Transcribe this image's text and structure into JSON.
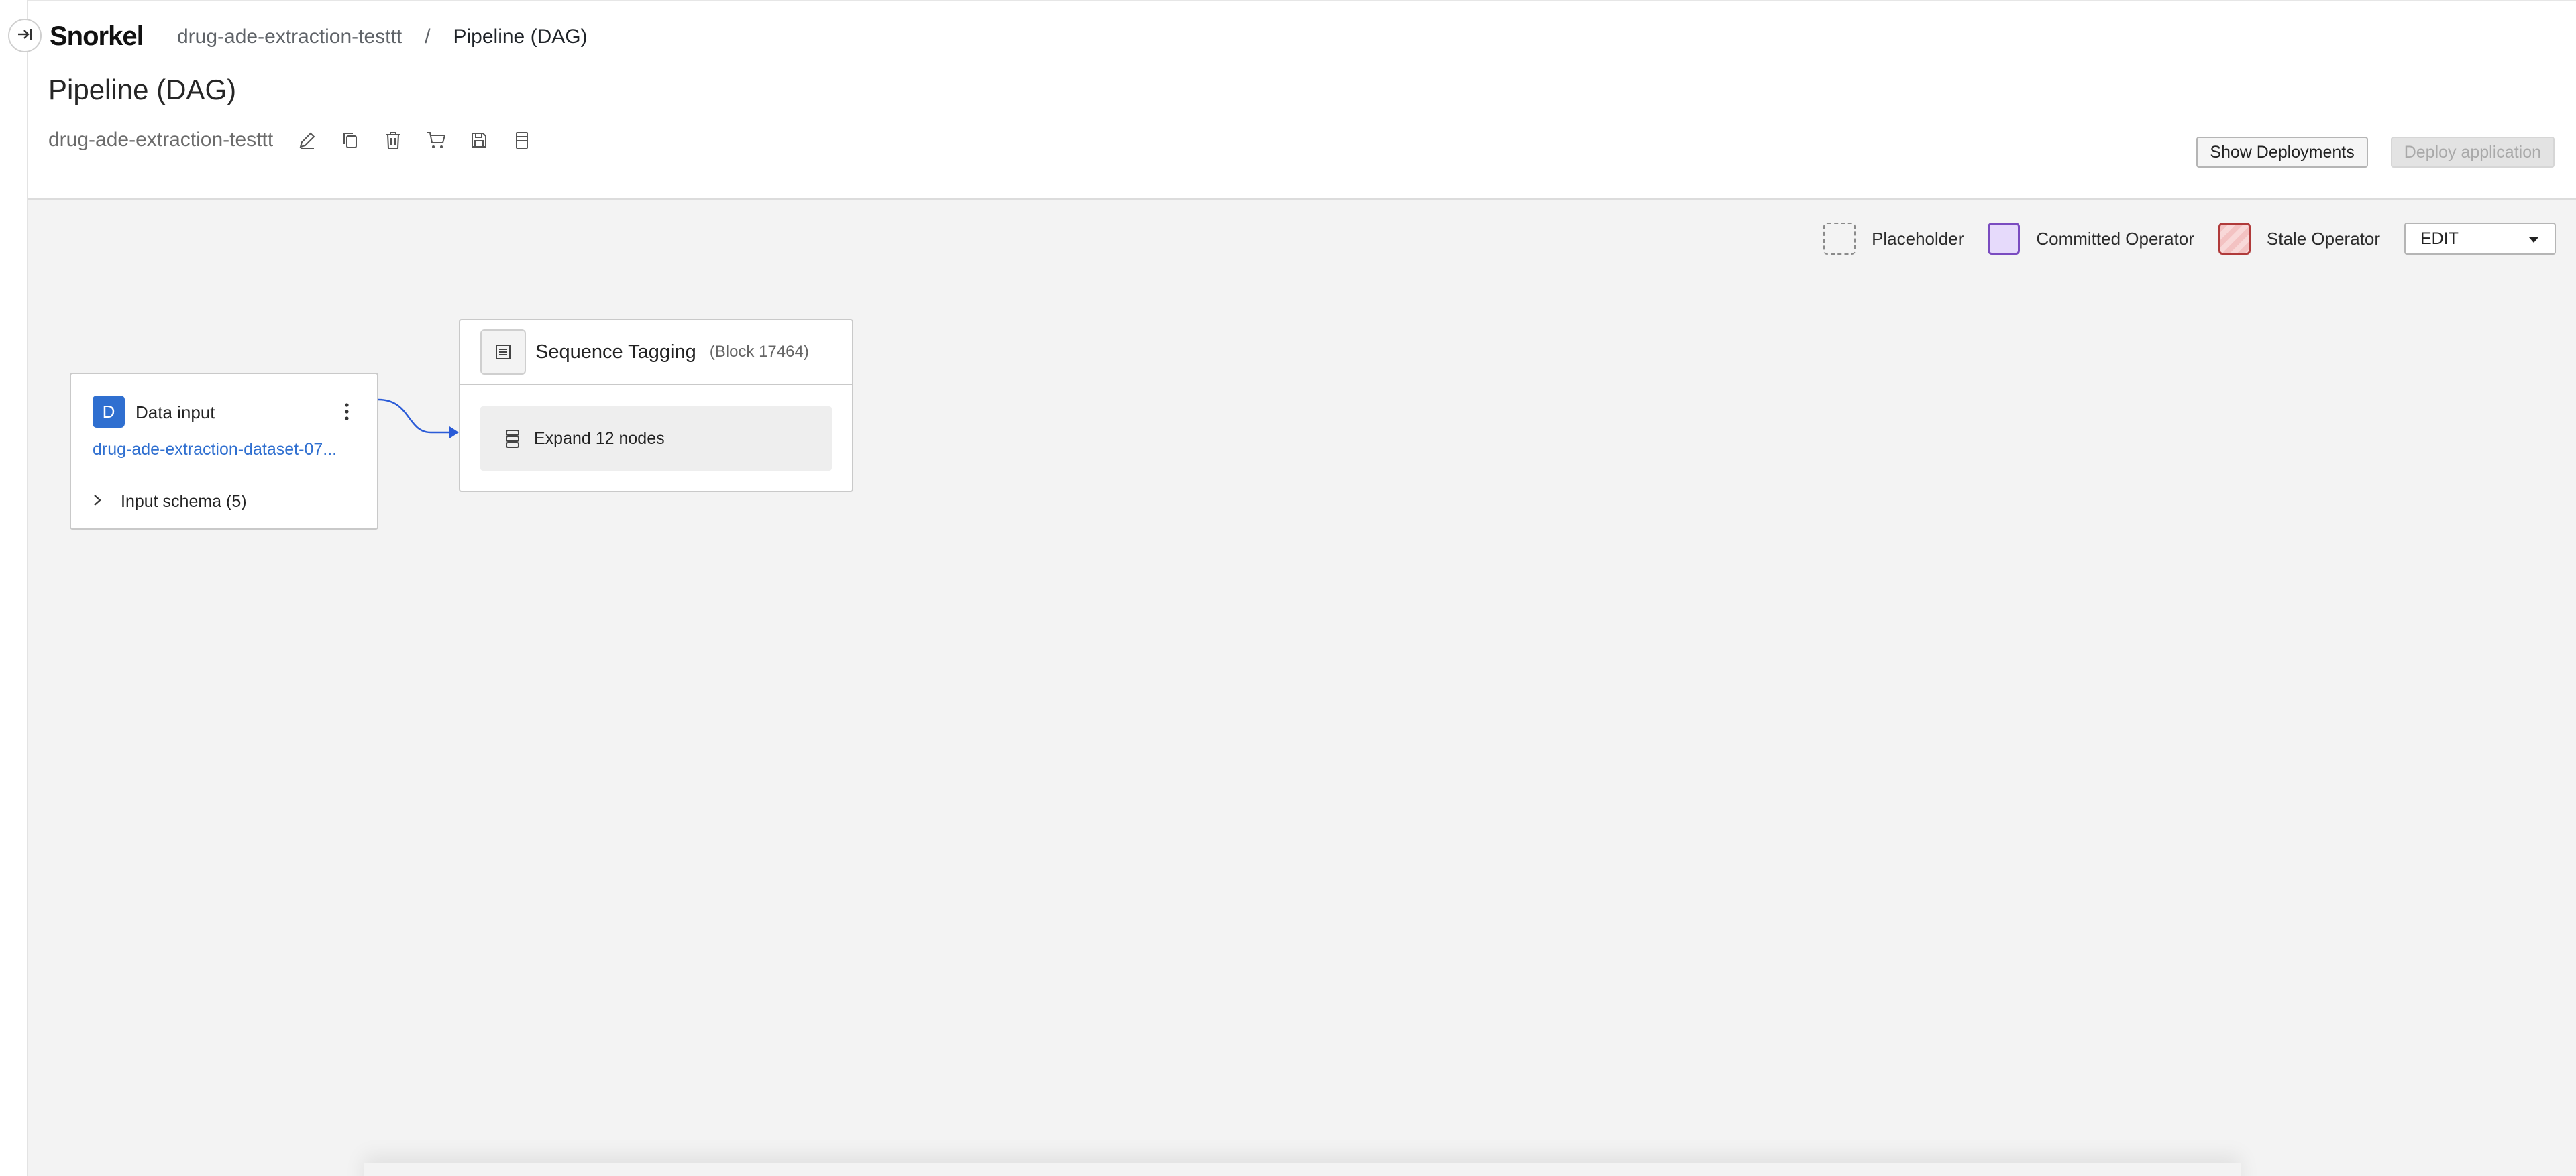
{
  "app": {
    "logo_text": "Snorkel",
    "breadcrumb": {
      "parent": "drug-ade-extraction-testtt",
      "separator": "/",
      "current": "Pipeline (DAG)"
    },
    "page_title": "Pipeline (DAG)",
    "application_name": "drug-ade-extraction-testtt",
    "toolbar_icons": [
      "edit-icon",
      "copy-icon",
      "trash-icon",
      "cart-icon",
      "save-icon",
      "archive-icon"
    ],
    "actions": {
      "show_deployments": "Show Deployments",
      "deploy_application": "Deploy application"
    }
  },
  "legend": {
    "placeholder": "Placeholder",
    "committed": "Committed Operator",
    "stale": "Stale Operator",
    "mode": "EDIT",
    "colors": {
      "committed_border": "#7a4bc0",
      "committed_fill": "#e6dafb",
      "stale_border": "#b03a3a",
      "stale_fill": "#f3c2c2"
    }
  },
  "nodes": {
    "data_input": {
      "badge": "D",
      "title": "Data input",
      "dataset": "drug-ade-extraction-dataset-07...",
      "schema": "Input schema (5)"
    },
    "block": {
      "title": "Sequence Tagging",
      "block_id": "(Block 17464)",
      "expand_label": "Expand 12 nodes"
    }
  },
  "colors": {
    "accent": "#2f6fd0",
    "canvas": "#f3f3f3"
  }
}
